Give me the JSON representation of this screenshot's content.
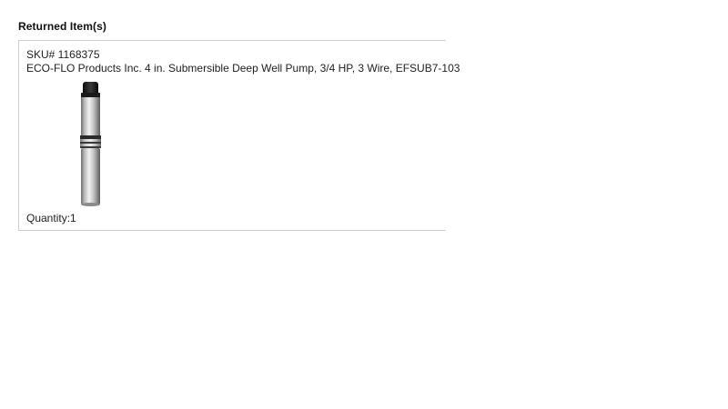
{
  "section": {
    "title": "Returned Item(s)"
  },
  "item": {
    "sku": "SKU# 1168375",
    "name": "ECO-FLO Products Inc. 4 in. Submersible Deep Well Pump, 3/4 HP, 3 Wire, EFSUB7-103",
    "image_icon": "submersible-pump-image",
    "quantity": "Quantity:1"
  }
}
